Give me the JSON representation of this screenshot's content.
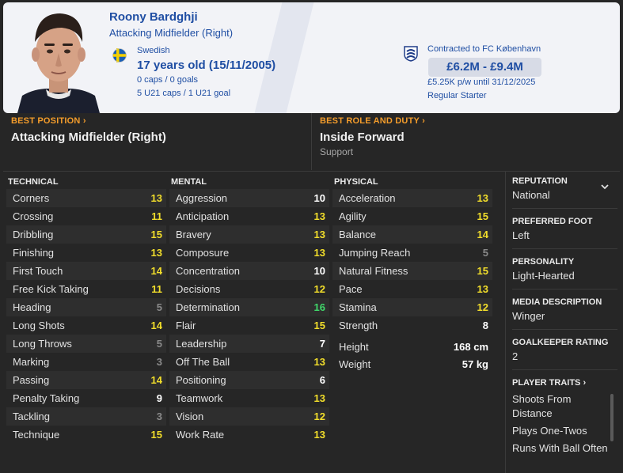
{
  "player": {
    "name": "Roony Bardghji",
    "position_title": "Attacking Midfielder (Right)",
    "nationality": "Swedish",
    "age": "17 years old (15/11/2005)",
    "caps": "0 caps / 0 goals",
    "u21_caps": "5 U21 caps / 1 U21 goal"
  },
  "contract": {
    "club_line": "Contracted to FC København",
    "value_range": "£6.2M - £9.4M",
    "wage_line": "£5.25K p/w until 31/12/2025",
    "squad_status": "Regular Starter"
  },
  "best_position": {
    "label": "BEST POSITION",
    "arrow": "›",
    "value": "Attacking Midfielder (Right)"
  },
  "best_role": {
    "label": "BEST ROLE AND DUTY",
    "arrow": "›",
    "value": "Inside Forward",
    "duty": "Support"
  },
  "colors": {
    "green": "#40d86a",
    "yellow": "#f2de2b",
    "white": "#ffffff",
    "grey": "#8a8a8a",
    "link_blue": "#1f4ea3",
    "accent_orange": "#f39c2b"
  },
  "technical": {
    "heading": "TECHNICAL",
    "rows": [
      {
        "name": "Corners",
        "value": "13"
      },
      {
        "name": "Crossing",
        "value": "11"
      },
      {
        "name": "Dribbling",
        "value": "15"
      },
      {
        "name": "Finishing",
        "value": "13"
      },
      {
        "name": "First Touch",
        "value": "14"
      },
      {
        "name": "Free Kick Taking",
        "value": "11"
      },
      {
        "name": "Heading",
        "value": "5"
      },
      {
        "name": "Long Shots",
        "value": "14"
      },
      {
        "name": "Long Throws",
        "value": "5"
      },
      {
        "name": "Marking",
        "value": "3"
      },
      {
        "name": "Passing",
        "value": "14"
      },
      {
        "name": "Penalty Taking",
        "value": "9"
      },
      {
        "name": "Tackling",
        "value": "3"
      },
      {
        "name": "Technique",
        "value": "15"
      }
    ]
  },
  "mental": {
    "heading": "MENTAL",
    "rows": [
      {
        "name": "Aggression",
        "value": "10"
      },
      {
        "name": "Anticipation",
        "value": "13"
      },
      {
        "name": "Bravery",
        "value": "13"
      },
      {
        "name": "Composure",
        "value": "13"
      },
      {
        "name": "Concentration",
        "value": "10"
      },
      {
        "name": "Decisions",
        "value": "12"
      },
      {
        "name": "Determination",
        "value": "16"
      },
      {
        "name": "Flair",
        "value": "15"
      },
      {
        "name": "Leadership",
        "value": "7"
      },
      {
        "name": "Off The Ball",
        "value": "13"
      },
      {
        "name": "Positioning",
        "value": "6"
      },
      {
        "name": "Teamwork",
        "value": "13"
      },
      {
        "name": "Vision",
        "value": "12"
      },
      {
        "name": "Work Rate",
        "value": "13"
      }
    ]
  },
  "physical": {
    "heading": "PHYSICAL",
    "rows": [
      {
        "name": "Acceleration",
        "value": "13"
      },
      {
        "name": "Agility",
        "value": "15"
      },
      {
        "name": "Balance",
        "value": "14"
      },
      {
        "name": "Jumping Reach",
        "value": "5"
      },
      {
        "name": "Natural Fitness",
        "value": "15"
      },
      {
        "name": "Pace",
        "value": "13"
      },
      {
        "name": "Stamina",
        "value": "12"
      },
      {
        "name": "Strength",
        "value": "8"
      }
    ],
    "height_label": "Height",
    "height_value": "168 cm",
    "weight_label": "Weight",
    "weight_value": "57 kg"
  },
  "sidebar": {
    "reputation_label": "REPUTATION",
    "reputation_value": "National",
    "foot_label": "PREFERRED FOOT",
    "foot_value": "Left",
    "personality_label": "PERSONALITY",
    "personality_value": "Light-Hearted",
    "media_label": "MEDIA DESCRIPTION",
    "media_value": "Winger",
    "gk_label": "GOALKEEPER RATING",
    "gk_value": "2",
    "traits_label": "PLAYER TRAITS",
    "traits_arrow": "›",
    "traits": [
      "Shoots From Distance",
      "Plays One-Twos",
      "Runs With Ball Often"
    ]
  }
}
